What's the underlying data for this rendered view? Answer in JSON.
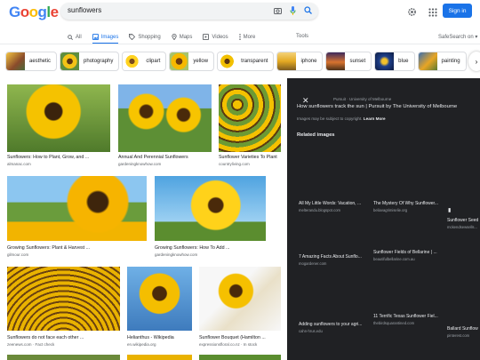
{
  "header": {
    "logo": [
      "G",
      "o",
      "o",
      "g",
      "l",
      "e"
    ],
    "logo_colors": [
      "#4285f4",
      "#ea4335",
      "#fbbc05",
      "#4285f4",
      "#34a853",
      "#ea4335"
    ],
    "query": "sunflowers",
    "signin_label": "Sign in"
  },
  "tabs": [
    {
      "label": "All",
      "icon": "search-icon"
    },
    {
      "label": "Images",
      "icon": "image-icon"
    },
    {
      "label": "Shopping",
      "icon": "tag-icon"
    },
    {
      "label": "Maps",
      "icon": "map-pin-icon"
    },
    {
      "label": "Videos",
      "icon": "video-icon"
    },
    {
      "label": "More",
      "icon": "more-icon"
    }
  ],
  "tools_label": "Tools",
  "safesearch_label": "SafeSearch on",
  "chips": [
    "aesthetic",
    "photography",
    "clipart",
    "yellow",
    "transparent",
    "iphone",
    "sunset",
    "blue",
    "painting"
  ],
  "results": [
    {
      "caption": "Sunflowers: How to Plant, Grow, and ...",
      "source": "almanac.com"
    },
    {
      "caption": "Annual And Perennial Sunflowers",
      "source": "gardeningknowhow.com"
    },
    {
      "caption": "Sunflower Varieties To Plant",
      "source": "countryliving.com"
    },
    {
      "caption": "Growing Sunflowers: Plant & Harvest ...",
      "source": "gilmour.com"
    },
    {
      "caption": "Growing Sunflowers: How To Add ...",
      "source": "gardeningknowhow.com"
    },
    {
      "caption": "Sunflowers do not face each other ...",
      "source": "zeenews.com · Fact check"
    },
    {
      "caption": "Helianthus - Wikipedia",
      "source": "en.wikipedia.org"
    },
    {
      "caption": "Sunflower Bouquet (Hamilton ...",
      "source": "expressionsfloral.co.nz · In stock"
    }
  ],
  "panel": {
    "source": "Pursuit · University of Melbourne",
    "title": "How sunflowers track the sun | Pursuit by The University of Melbourne",
    "note": "Images may be subject to copyright.",
    "learn_more": "Learn More",
    "related_heading": "Related images",
    "related": [
      {
        "caption": "All My Little Words: Vacation, ...",
        "source": "melterandu.blogspot.com"
      },
      {
        "caption": "The Mystery Of Why Sunflower...",
        "source": "beliavagrimiselie.org"
      },
      {
        "caption": "Sunflower Seed",
        "source": "mckendsewsells..."
      },
      {
        "caption": "7 Amazing Facts About Sunflo...",
        "source": "mogardener.com"
      },
      {
        "caption": "Sunflower Fields of Bellarine | ...",
        "source": "beautifulbellarine.com.au"
      },
      {
        "caption": "Adding sunflowers to your agri...",
        "source": "cahn-hrus.edu"
      },
      {
        "caption": "11 Terrific Texas Sunflower Fiel...",
        "source": "thebirdsquarantined.com"
      },
      {
        "caption": "Ballard Sunflow",
        "source": "pinterest.com"
      }
    ]
  }
}
